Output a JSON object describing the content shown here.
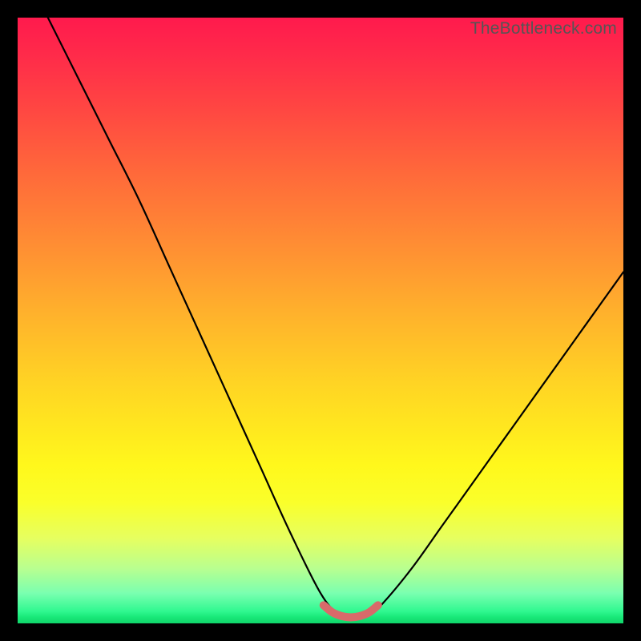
{
  "watermark": "TheBottleneck.com",
  "chart_data": {
    "type": "line",
    "title": "",
    "xlabel": "",
    "ylabel": "",
    "xlim": [
      0,
      100
    ],
    "ylim": [
      0,
      100
    ],
    "series": [
      {
        "name": "bottleneck-curve",
        "x": [
          5,
          10,
          15,
          20,
          25,
          30,
          35,
          40,
          45,
          50,
          53,
          55,
          58,
          60,
          65,
          70,
          75,
          80,
          85,
          90,
          95,
          100
        ],
        "values": [
          100,
          90,
          80,
          70,
          59,
          48,
          37,
          26,
          15,
          5,
          1.5,
          1,
          1.5,
          3,
          9,
          16,
          23,
          30,
          37,
          44,
          51,
          58
        ]
      }
    ],
    "highlight": {
      "name": "flat-region",
      "x": [
        50.5,
        52,
        53.5,
        55,
        56.5,
        58,
        59.5
      ],
      "values": [
        3.0,
        1.8,
        1.2,
        1.0,
        1.2,
        1.8,
        3.0
      ]
    },
    "gradient_stops": [
      {
        "pos": 0,
        "color": "#ff1a4d"
      },
      {
        "pos": 14,
        "color": "#ff4343"
      },
      {
        "pos": 38,
        "color": "#ff8f33"
      },
      {
        "pos": 60,
        "color": "#ffd324"
      },
      {
        "pos": 80,
        "color": "#faff2a"
      },
      {
        "pos": 95,
        "color": "#7affb0"
      },
      {
        "pos": 100,
        "color": "#10d46a"
      }
    ],
    "colors": {
      "curve": "#000000",
      "highlight": "#d86a6a",
      "background_frame": "#000000"
    }
  }
}
